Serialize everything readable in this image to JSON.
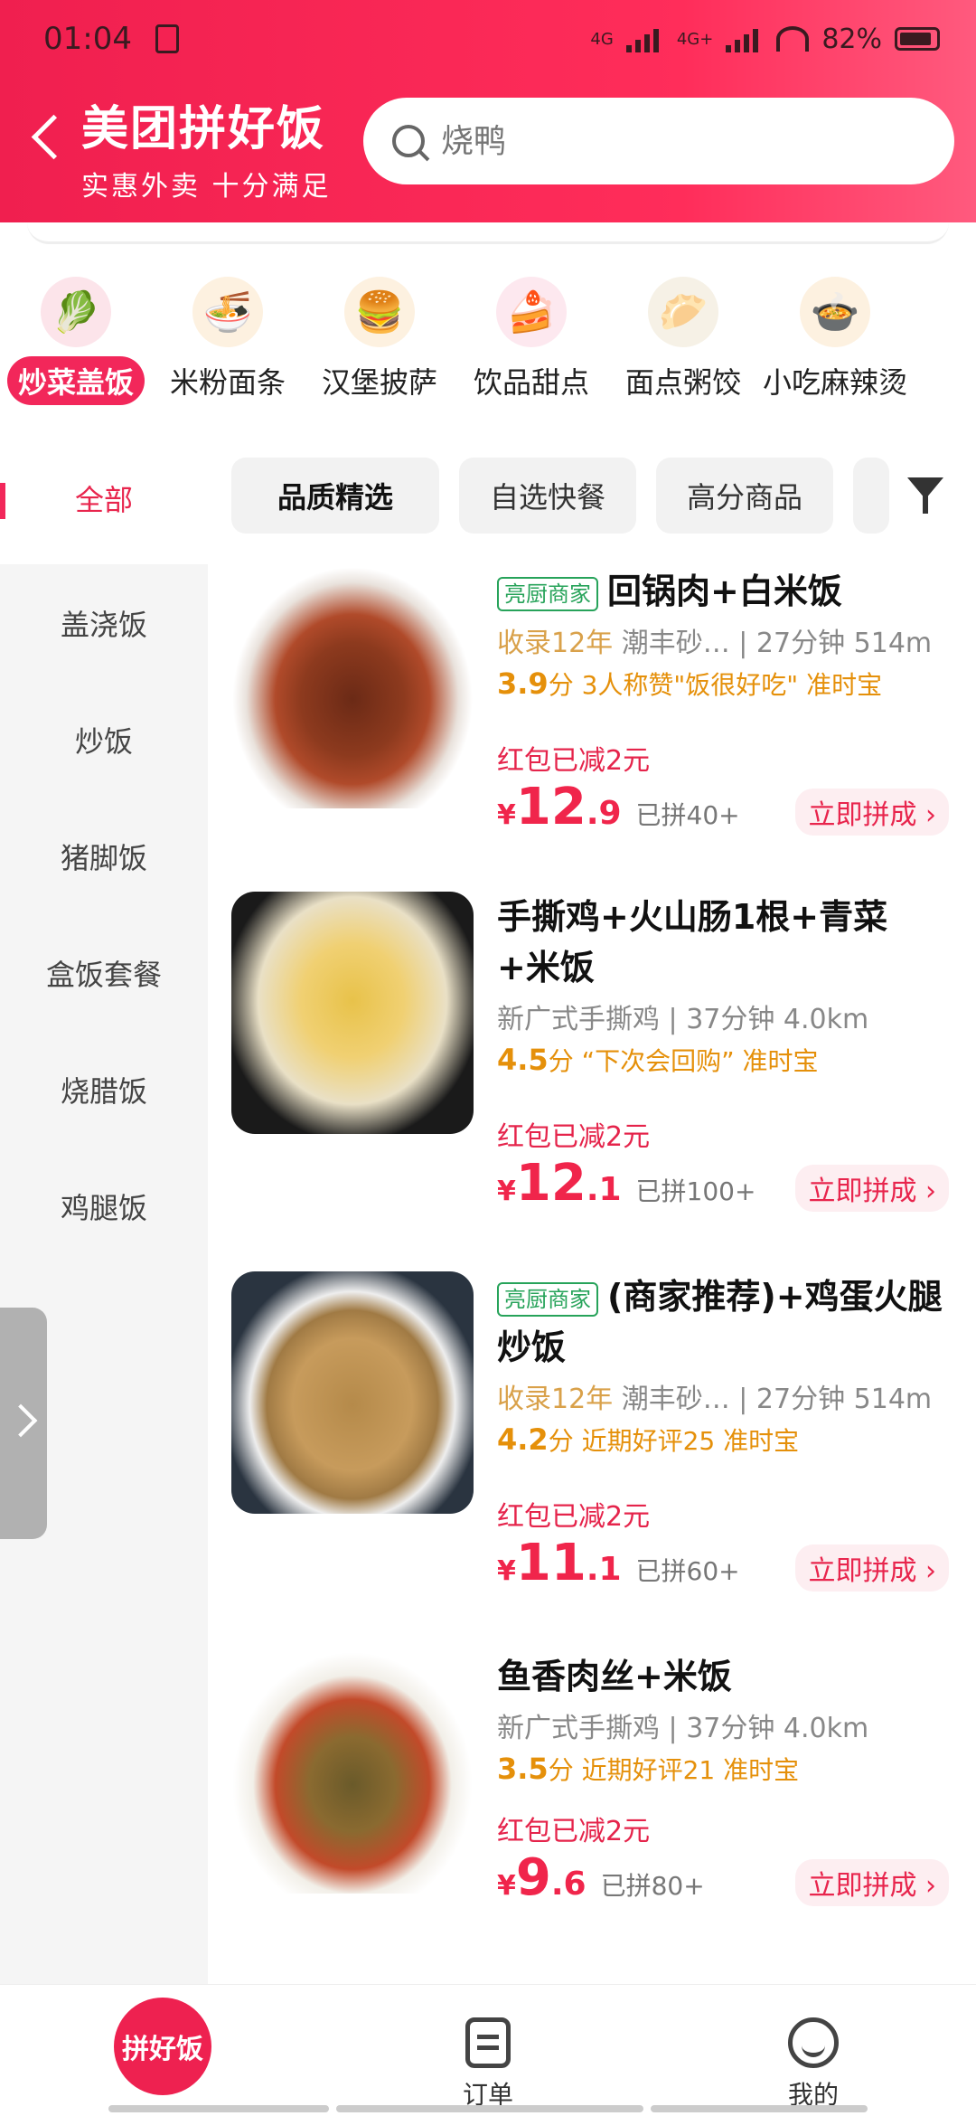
{
  "status": {
    "time": "01:04",
    "battery": "82%",
    "net1": "4G",
    "net2": "4G+"
  },
  "header": {
    "title": "美团拼好饭",
    "subtitle": "实惠外卖 十分满足",
    "search_placeholder": "烧鸭"
  },
  "categories": [
    {
      "label": "炒菜盖饭",
      "icon": "🥬",
      "active": true
    },
    {
      "label": "米粉面条",
      "icon": "🍜"
    },
    {
      "label": "汉堡披萨",
      "icon": "🍔"
    },
    {
      "label": "饮品甜点",
      "icon": "🍰"
    },
    {
      "label": "面点粥饺",
      "icon": "🥟"
    },
    {
      "label": "小吃麻辣烫",
      "icon": "🍲"
    }
  ],
  "filters": {
    "all": "全部",
    "chips": [
      "品质精选",
      "自选快餐",
      "高分商品"
    ]
  },
  "sidebar": [
    "盖浇饭",
    "炒饭",
    "猪脚饭",
    "盒饭套餐",
    "烧腊饭",
    "鸡腿饭"
  ],
  "items": [
    {
      "tag": "亮厨商家",
      "title": "回锅肉+白米饭",
      "years": "收录12年",
      "shop": "潮丰砂…",
      "time": "27分钟",
      "dist": "514m",
      "score": "3.9",
      "comment": "3人称赞\"饭很好吃\"",
      "badge": "准时宝",
      "promo": "红包已减2元",
      "price_int": "12",
      "price_dec": ".9",
      "sold": "已拼40+",
      "button": "立即拼成"
    },
    {
      "tag": "",
      "title": "手撕鸡+火山肠1根+青菜+米饭",
      "years": "",
      "shop": "新广式手撕鸡",
      "time": "37分钟",
      "dist": "4.0km",
      "score": "4.5",
      "comment": "“下次会回购”",
      "badge": "准时宝",
      "promo": "红包已减2元",
      "price_int": "12",
      "price_dec": ".1",
      "sold": "已拼100+",
      "button": "立即拼成"
    },
    {
      "tag": "亮厨商家",
      "title": "(商家推荐)+鸡蛋火腿炒饭",
      "years": "收录12年",
      "shop": "潮丰砂…",
      "time": "27分钟",
      "dist": "514m",
      "score": "4.2",
      "comment": "近期好评25",
      "badge": "准时宝",
      "promo": "红包已减2元",
      "price_int": "11",
      "price_dec": ".1",
      "sold": "已拼60+",
      "button": "立即拼成"
    },
    {
      "tag": "",
      "title": "鱼香肉丝+米饭",
      "years": "",
      "shop": "新广式手撕鸡",
      "time": "37分钟",
      "dist": "4.0km",
      "score": "3.5",
      "comment": "近期好评21",
      "badge": "准时宝",
      "promo": "红包已减2元",
      "price_int": "9",
      "price_dec": ".6",
      "sold": "已拼80+",
      "button": "立即拼成"
    }
  ],
  "tabbar": {
    "home": "拼好饭",
    "orders": "订单",
    "me": "我的"
  },
  "currency": "¥",
  "score_unit": "分",
  "colors": {
    "brand": "#f2275a",
    "price": "#f0254b",
    "score": "#e5900a",
    "tag": "#27a35a"
  }
}
